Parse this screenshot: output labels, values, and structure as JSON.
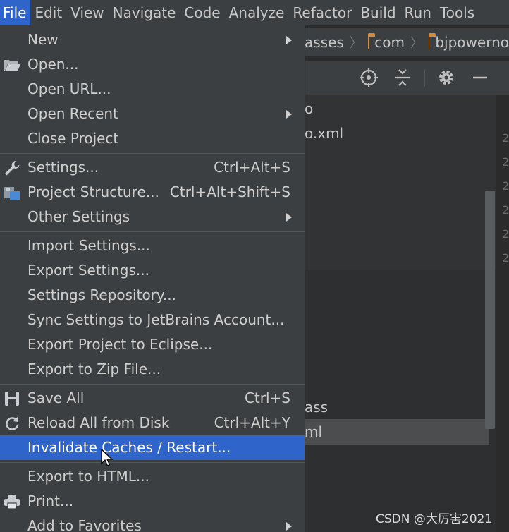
{
  "menubar": {
    "items": [
      "File",
      "Edit",
      "View",
      "Navigate",
      "Code",
      "Analyze",
      "Refactor",
      "Build",
      "Run",
      "Tools"
    ]
  },
  "breadcrumb": {
    "items": [
      "asses",
      "com",
      "bjpowerno"
    ]
  },
  "project_tree": {
    "rows": [
      "o",
      "o.xml",
      "ass",
      "ml"
    ]
  },
  "gutter": {
    "digits": [
      "2",
      "2",
      "2",
      "2",
      "2",
      "2"
    ]
  },
  "menu": {
    "group1": [
      {
        "label": "New",
        "submenu": true
      },
      {
        "label": "Open...",
        "icon": "open-folder-icon"
      },
      {
        "label": "Open URL..."
      },
      {
        "label": "Open Recent",
        "submenu": true
      },
      {
        "label": "Close Project"
      }
    ],
    "group2": [
      {
        "label": "Settings...",
        "shortcut": "Ctrl+Alt+S",
        "icon": "wrench-icon"
      },
      {
        "label": "Project Structure...",
        "shortcut": "Ctrl+Alt+Shift+S",
        "icon": "project-structure-icon"
      },
      {
        "label": "Other Settings",
        "submenu": true
      }
    ],
    "group3": [
      {
        "label": "Import Settings..."
      },
      {
        "label": "Export Settings..."
      },
      {
        "label": "Settings Repository..."
      },
      {
        "label": "Sync Settings to JetBrains Account..."
      },
      {
        "label": "Export Project to Eclipse..."
      },
      {
        "label": "Export to Zip File..."
      }
    ],
    "group4": [
      {
        "label": "Save All",
        "shortcut": "Ctrl+S",
        "icon": "save-icon"
      },
      {
        "label": "Reload All from Disk",
        "shortcut": "Ctrl+Alt+Y",
        "icon": "reload-icon"
      },
      {
        "label": "Invalidate Caches / Restart...",
        "highlighted": true
      }
    ],
    "group5": [
      {
        "label": "Export to HTML..."
      },
      {
        "label": "Print...",
        "icon": "printer-icon"
      },
      {
        "label": "Add to Favorites",
        "submenu": true
      }
    ]
  },
  "watermark": "CSDN @大厉害2021",
  "colors": {
    "menubar_bg": "#3c3f41",
    "highlight": "#2f65ca",
    "editor_bg": "#2b2b2b",
    "folder": "#d78a3a"
  }
}
